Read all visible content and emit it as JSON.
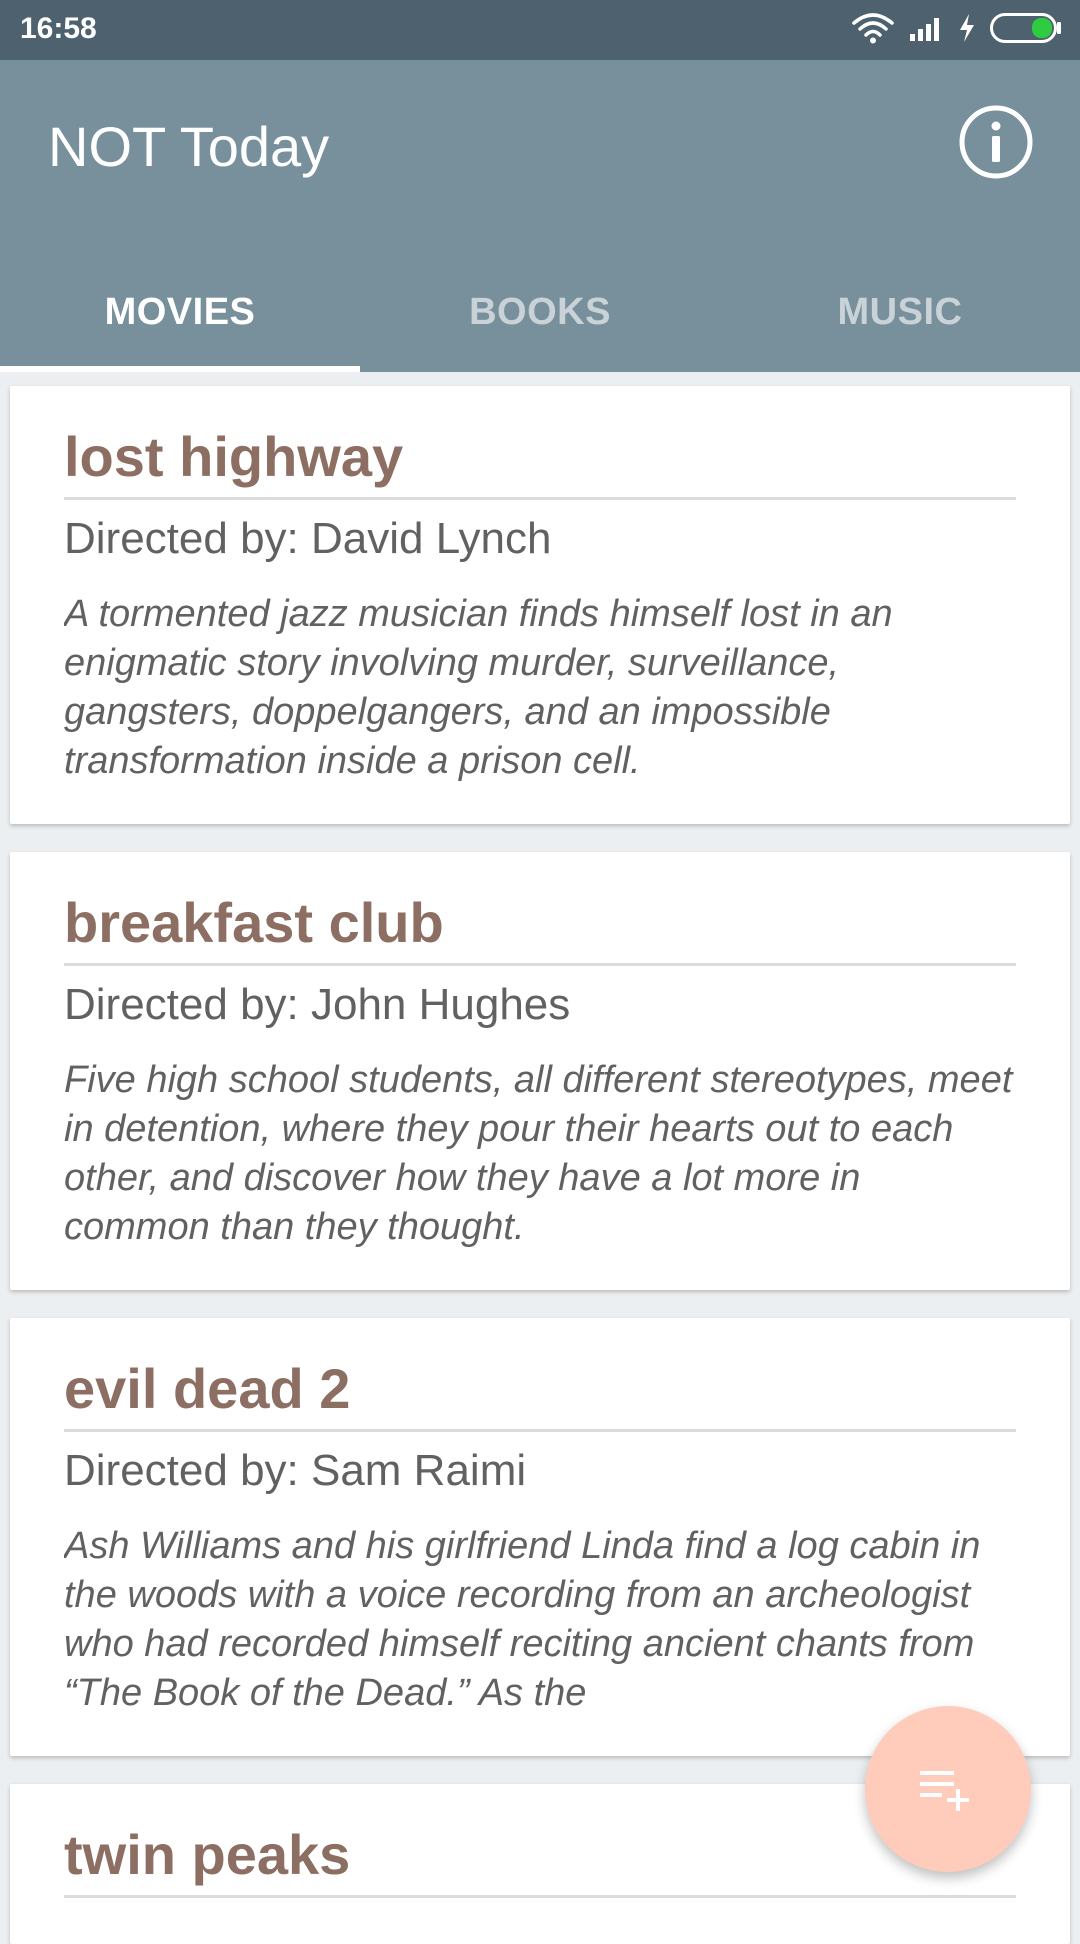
{
  "status_bar": {
    "time": "16:58",
    "icons": [
      "wifi-icon",
      "signal-icon",
      "charging-icon",
      "battery-icon"
    ]
  },
  "app_bar": {
    "title": "NOT Today",
    "info_icon": "info-icon",
    "background_color": "#78909c"
  },
  "tabs": [
    {
      "label": "MOVIES",
      "active": true
    },
    {
      "label": "BOOKS",
      "active": false
    },
    {
      "label": "MUSIC",
      "active": false
    }
  ],
  "movies": [
    {
      "title": "lost highway",
      "director": "Directed by: David Lynch",
      "description": "A tormented jazz musician finds himself lost in an enigmatic story involving murder, surveillance, gangsters, doppelgangers, and an impossible transformation inside a prison cell."
    },
    {
      "title": "breakfast club",
      "director": "Directed by: John Hughes",
      "description": "Five high school students, all different stereotypes, meet in detention, where they pour their hearts out to each other, and discover how they have a lot more in common than they thought."
    },
    {
      "title": "evil dead 2",
      "director": "Directed by: Sam Raimi",
      "description": "Ash Williams and his girlfriend Linda find a log cabin in the woods with a voice recording from an archeologist who had recorded himself reciting ancient chants from “The Book of the Dead.” As the"
    },
    {
      "title": "twin peaks",
      "director": "",
      "description": ""
    }
  ],
  "fab": {
    "icon": "playlist-add-icon",
    "color": "#ffccbc"
  },
  "colors": {
    "title_brown": "#8d6e63",
    "status_bar": "#4d626e",
    "background": "#eceff1"
  }
}
